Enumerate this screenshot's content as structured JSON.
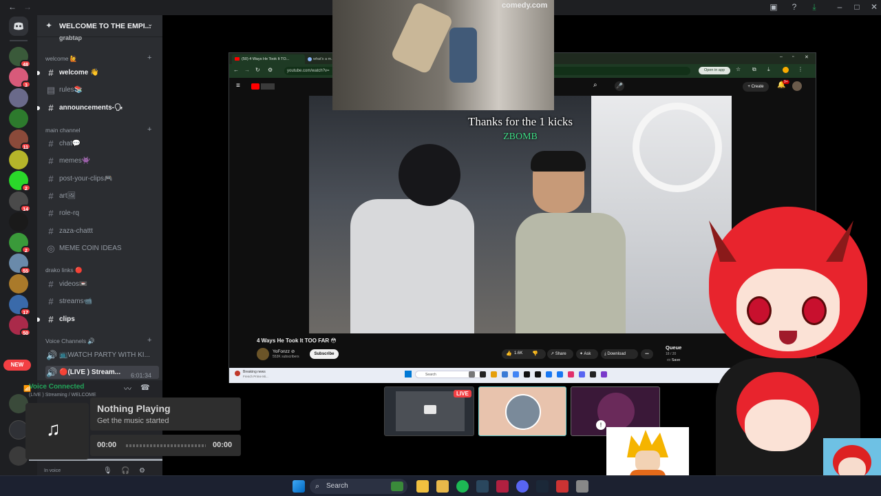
{
  "discord": {
    "guild_name": "WELCOME TO THE EMPI...",
    "partial_top_channel": "grabtap",
    "categories": {
      "welcome": "welcome 🙋",
      "main": "main channel",
      "drako": "drako links 🔴",
      "voice": "Voice Channels 🔊"
    },
    "channels": [
      {
        "icon": "#",
        "label": "welcome 👋",
        "unread": true
      },
      {
        "icon": "▤",
        "label": "rules📚",
        "unread": false
      },
      {
        "icon": "#",
        "label": "announcements-🗣",
        "unread": true
      },
      {
        "icon": "#",
        "label": "chat💬",
        "unread": false
      },
      {
        "icon": "#",
        "label": "memes👾",
        "unread": false
      },
      {
        "icon": "#",
        "label": "post-your-clips🎮",
        "unread": false
      },
      {
        "icon": "#",
        "label": "art🖼",
        "unread": false
      },
      {
        "icon": "#",
        "label": "role-rq",
        "unread": false
      },
      {
        "icon": "#",
        "label": "zaza-chattt",
        "unread": false
      },
      {
        "icon": "◎",
        "label": "MEME COIN IDEAS",
        "unread": false
      },
      {
        "icon": "#",
        "label": "videos📼",
        "unread": false
      },
      {
        "icon": "#",
        "label": "streams📹",
        "unread": false
      },
      {
        "icon": "#",
        "label": "clips",
        "unread": true
      },
      {
        "icon": "🔊",
        "label": "📺WATCH PARTY WITH KI...",
        "unread": false
      },
      {
        "icon": "🔊",
        "label": "🔴(LIVE ) Stream...",
        "unread": true
      }
    ],
    "live_timer": "6:01:34",
    "voice_connected": "Voice Connected",
    "voice_sub": "(LIVE ) Streaming / WELCOME",
    "in_voice": "In voice",
    "server_badges": [
      "48",
      "3",
      "",
      "",
      "11",
      "",
      "2",
      "14",
      "",
      "2",
      "55",
      "",
      "17",
      "50"
    ],
    "new_label": "NEW"
  },
  "now_playing": {
    "title": "Nothing Playing",
    "subtitle": "Get the music started",
    "time_start": "00:00",
    "time_end": "00:00"
  },
  "webcam": {
    "watermark": "comedy.com"
  },
  "browser": {
    "tab1": "(50) 4 Ways He Took It TO...",
    "tab2": "what's a m...",
    "url": "youtube.com/watch?v=",
    "open_in_app": "Open in app",
    "create": "+ Create",
    "notif_count": "9+"
  },
  "video": {
    "caption_line1": "Thanks for the 1 kicks",
    "caption_line2": "ZBOMB",
    "title": "4 Ways He Took It TOO FAR 😳",
    "channel": "YoFonzz ⊘",
    "subscribers": "553K subscribers",
    "subscribe": "Subscribe",
    "likes": "1.6K",
    "share": "Share",
    "ask": "Ask",
    "download": "Download",
    "more": "•••",
    "queue": "Queue",
    "queue_count": "18 / 20",
    "save": "Save"
  },
  "mini_taskbar": {
    "search": "Search",
    "news_title": "Breaking news",
    "news_sub": "French Prime Mi..."
  },
  "tiles": {
    "live_badge": "LIVE"
  },
  "taskbar": {
    "search": "Search"
  },
  "colors": {
    "discord_bg": "#2b2d31",
    "rail": "#1e1f22",
    "accent_green": "#23a55a",
    "live_red": "#f23f43",
    "youtube_red": "#ff0000",
    "browser_green": "#1e3a24"
  }
}
